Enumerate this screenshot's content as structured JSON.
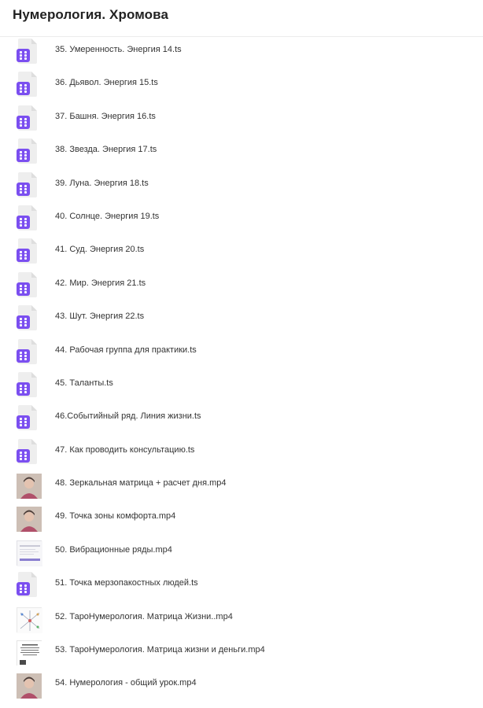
{
  "header": {
    "title": "Нумерология. Хромова"
  },
  "files": [
    {
      "name": "35. Умеренность. Энергия 14.ts",
      "kind": "ts"
    },
    {
      "name": "36. Дьявол. Энергия 15.ts",
      "kind": "ts"
    },
    {
      "name": "37. Башня. Энергия 16.ts",
      "kind": "ts"
    },
    {
      "name": "38. Звезда. Энергия 17.ts",
      "kind": "ts"
    },
    {
      "name": "39. Луна. Энергия 18.ts",
      "kind": "ts"
    },
    {
      "name": "40. Солнце. Энергия 19.ts",
      "kind": "ts"
    },
    {
      "name": "41. Суд. Энергия 20.ts",
      "kind": "ts"
    },
    {
      "name": "42. Мир. Энергия 21.ts",
      "kind": "ts"
    },
    {
      "name": "43. Шут. Энергия 22.ts",
      "kind": "ts"
    },
    {
      "name": "44. Рабочая группа для практики.ts",
      "kind": "ts"
    },
    {
      "name": "45. Таланты.ts",
      "kind": "ts"
    },
    {
      "name": "46.Событийный ряд. Линия жизни.ts",
      "kind": "ts"
    },
    {
      "name": "47. Как проводить консультацию.ts",
      "kind": "ts"
    },
    {
      "name": "48. Зеркальная матрица + расчет дня.mp4",
      "kind": "mp4",
      "thumb": "face"
    },
    {
      "name": "49. Точка зоны комфорта.mp4",
      "kind": "mp4",
      "thumb": "face"
    },
    {
      "name": "50. Вибрационные ряды.mp4",
      "kind": "mp4",
      "thumb": "doc"
    },
    {
      "name": "51. Точка мерзопакостных людей.ts",
      "kind": "ts"
    },
    {
      "name": "52. ТароНумерология. Матрица Жизни..mp4",
      "kind": "mp4",
      "thumb": "diagram"
    },
    {
      "name": "53. ТароНумерология. Матрица жизни и деньги.mp4",
      "kind": "mp4",
      "thumb": "text"
    },
    {
      "name": "54. Нумерология - общий урок.mp4",
      "kind": "mp4",
      "thumb": "face"
    }
  ],
  "icons": {
    "ts": "video-file-icon",
    "mp4": "video-thumbnail"
  },
  "colors": {
    "accent": "#7b4ff0",
    "file_page": "#eeeeee",
    "divider": "#ececec"
  }
}
